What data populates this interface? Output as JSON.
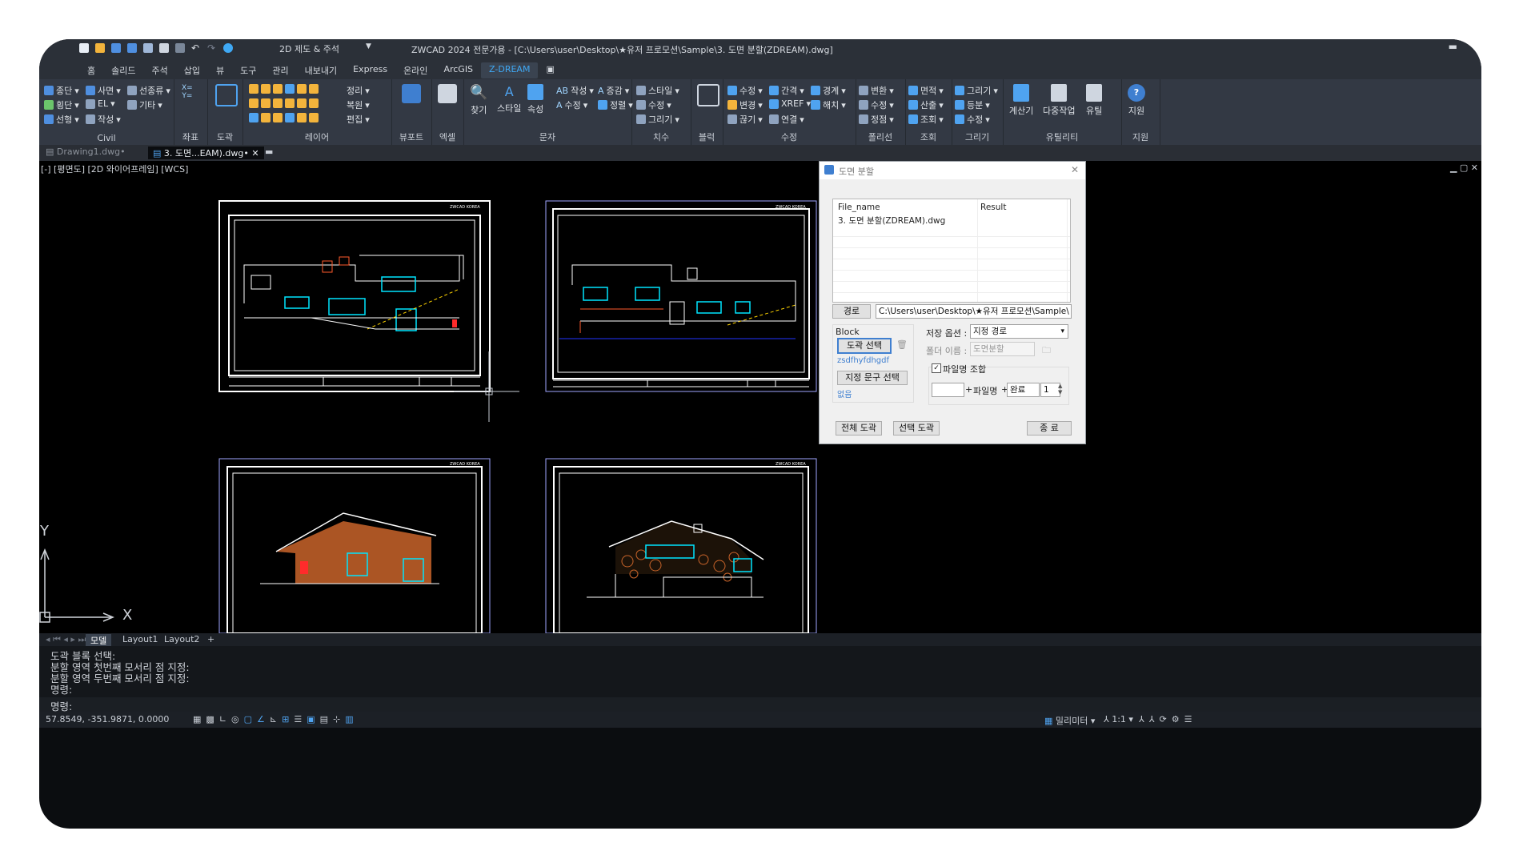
{
  "titlebar": {
    "workspace": "2D 제도 & 주석",
    "title": "ZWCAD 2024 전문가용 - [C:\\Users\\user\\Desktop\\★유저 프로모션\\Sample\\3. 도면 분할(ZDREAM).dwg]"
  },
  "menu": {
    "tabs": [
      "홈",
      "솔리드",
      "주석",
      "삽입",
      "뷰",
      "도구",
      "관리",
      "내보내기",
      "Express",
      "온라인",
      "ArcGIS",
      "Z-DREAM"
    ],
    "active": "Z-DREAM"
  },
  "ribbon": {
    "panels": [
      {
        "label": "Civil",
        "buttons": [
          "종단",
          "사면",
          "선종류",
          "횡단",
          "EL",
          "기타",
          "선형",
          "작성"
        ]
      },
      {
        "label": "좌표",
        "buttons": [
          "X=",
          "Y="
        ]
      },
      {
        "label": "도곽",
        "buttons": []
      },
      {
        "label": "레이어",
        "buttons": [
          "정리",
          "복원",
          "편집"
        ]
      },
      {
        "label": "뷰포트",
        "buttons": []
      },
      {
        "label": "엑셀",
        "buttons": []
      },
      {
        "label": "문자",
        "buttons": [
          "찾기",
          "스타일",
          "속성",
          "작성",
          "증감",
          "수정",
          "정렬"
        ]
      },
      {
        "label": "치수",
        "buttons": [
          "스타일",
          "수정",
          "그리기"
        ]
      },
      {
        "label": "블럭",
        "buttons": []
      },
      {
        "label": "수정",
        "buttons": [
          "수정",
          "간격",
          "경계",
          "변경",
          "XREF",
          "해치",
          "끊기",
          "연결"
        ]
      },
      {
        "label": "폴리선",
        "buttons": [
          "변환",
          "수정",
          "정점"
        ]
      },
      {
        "label": "조회",
        "buttons": [
          "면적",
          "산출",
          "조회"
        ]
      },
      {
        "label": "그리기",
        "buttons": [
          "그리기",
          "등분",
          "수정"
        ]
      },
      {
        "label": "유틸리티",
        "buttons": [
          "계산기",
          "다중작업",
          "유틸"
        ]
      },
      {
        "label": "지원",
        "buttons": [
          "지원"
        ]
      }
    ]
  },
  "doctabs": [
    "Drawing1.dwg•",
    "3. 도면...EAM).dwg•"
  ],
  "viewport_label": "[-] [평면도] [2D 와이어프레임] [WCS]",
  "sheets": [
    {
      "header": "ZWCAD KOREA"
    },
    {
      "header": "ZWCAD KOREA"
    },
    {
      "header": "ZWCAD KOREA"
    },
    {
      "header": "ZWCAD KOREA"
    }
  ],
  "ucs": {
    "x": "X",
    "y": "Y"
  },
  "layout_tabs": [
    "모델",
    "Layout1",
    "Layout2",
    "+"
  ],
  "active_layout": "모델",
  "command_history": [
    "도곽 블록 선택:",
    "분할 영역 첫번째 모서리 점 지정:",
    "분할 영역 두번째 모서리 점 지정:",
    "명령:"
  ],
  "command_prompt": "명령:",
  "status": {
    "coords": "57.8549, -351.9871, 0.0000",
    "unit": "밀리미터",
    "scale": "1:1"
  },
  "dialog": {
    "title": "도면 분할",
    "table_headers": [
      "File_name",
      "Result"
    ],
    "table_rows": [
      [
        "3. 도면 분할(ZDREAM).dwg",
        ""
      ]
    ],
    "path_button": "경로",
    "path_value": "C:\\Users\\user\\Desktop\\★유저 프로모션\\Sample\\",
    "block_label": "Block",
    "select_block_button": "도곽 선택",
    "block_name": "zsdfhyfdhgdf",
    "select_text_button": "지정 문구 선택",
    "text_value": "없음",
    "save_option_label": "저장 옵션 :",
    "save_option_value": "지정 경로",
    "folder_label": "폴더 이름 :",
    "folder_value": "도면분할",
    "filename_combine_label": "파일명 조합",
    "filename_prefix": "",
    "plus1": "+",
    "filename_word": "파일명",
    "plus2": "+",
    "suffix": "완료",
    "number": "1",
    "btn_all": "전체 도곽",
    "btn_selected": "선택 도곽",
    "btn_close": "종 료"
  },
  "colors": {
    "accent": "#3fa9f5",
    "canvas": "#000000",
    "ribbon": "#333944",
    "frame_white": "#ffffff",
    "cyan": "#00e5ff",
    "red": "#ff2b2b",
    "yellow": "#ffd400",
    "brick": "#c9642a"
  }
}
